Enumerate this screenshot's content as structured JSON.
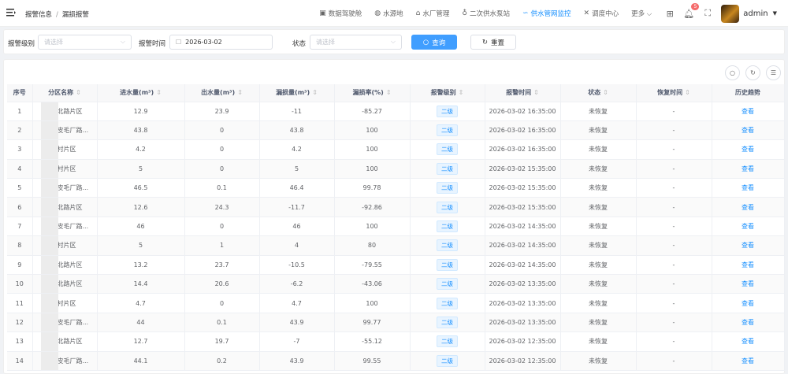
{
  "breadcrumb": [
    "报警信息",
    "漏损报警"
  ],
  "nav": [
    {
      "label": "数据驾驶舱",
      "icon": "monitor-icon",
      "glyph": "▣"
    },
    {
      "label": "水源地",
      "icon": "water-source-icon",
      "glyph": "◍"
    },
    {
      "label": "水厂管理",
      "icon": "home-icon",
      "glyph": "⌂"
    },
    {
      "label": "二次供水泵站",
      "icon": "pump-icon",
      "glyph": "♁"
    },
    {
      "label": "供水管网监控",
      "icon": "pipe-icon",
      "glyph": "∽",
      "active": true
    },
    {
      "label": "调度中心",
      "icon": "tools-icon",
      "glyph": "✕"
    },
    {
      "label": "更多 ⌵",
      "icon": "",
      "glyph": ""
    }
  ],
  "notification_count": "5",
  "user": "admin",
  "filters": {
    "level_label": "报警级别",
    "level_placeholder": "请选择",
    "time_label": "报警时间",
    "time_value": "2026-03-02",
    "status_label": "状态",
    "status_placeholder": "请选择",
    "search": "查询",
    "reset": "重置"
  },
  "columns": [
    "序号",
    "分区名称",
    "进水量(m³)",
    "出水量(m³)",
    "漏损量(m³)",
    "漏损率(%)",
    "报警级别",
    "报警时间",
    "状态",
    "恢复时间",
    "历史趋势"
  ],
  "sortable": [
    false,
    true,
    true,
    true,
    true,
    true,
    true,
    true,
    true,
    true,
    false
  ],
  "rows": [
    [
      "1",
      "北路片区",
      "12.9",
      "23.9",
      "-11",
      "-85.27",
      "二级",
      "2026-03-02 16:35:00",
      "未恢复",
      "-",
      "查看"
    ],
    [
      "2",
      "皮毛厂路...",
      "43.8",
      "0",
      "43.8",
      "100",
      "二级",
      "2026-03-02 16:35:00",
      "未恢复",
      "-",
      "查看"
    ],
    [
      "3",
      "村片区",
      "4.2",
      "0",
      "4.2",
      "100",
      "二级",
      "2026-03-02 16:35:00",
      "未恢复",
      "-",
      "查看"
    ],
    [
      "4",
      "村片区",
      "5",
      "0",
      "5",
      "100",
      "二级",
      "2026-03-02 15:35:00",
      "未恢复",
      "-",
      "查看"
    ],
    [
      "5",
      "皮毛厂路...",
      "46.5",
      "0.1",
      "46.4",
      "99.78",
      "二级",
      "2026-03-02 15:35:00",
      "未恢复",
      "-",
      "查看"
    ],
    [
      "6",
      "北路片区",
      "12.6",
      "24.3",
      "-11.7",
      "-92.86",
      "二级",
      "2026-03-02 15:35:00",
      "未恢复",
      "-",
      "查看"
    ],
    [
      "7",
      "皮毛厂路...",
      "46",
      "0",
      "46",
      "100",
      "二级",
      "2026-03-02 14:35:00",
      "未恢复",
      "-",
      "查看"
    ],
    [
      "8",
      "村片区",
      "5",
      "1",
      "4",
      "80",
      "二级",
      "2026-03-02 14:35:00",
      "未恢复",
      "-",
      "查看"
    ],
    [
      "9",
      "北路片区",
      "13.2",
      "23.7",
      "-10.5",
      "-79.55",
      "二级",
      "2026-03-02 14:35:00",
      "未恢复",
      "-",
      "查看"
    ],
    [
      "10",
      "北路片区",
      "14.4",
      "20.6",
      "-6.2",
      "-43.06",
      "二级",
      "2026-03-02 13:35:00",
      "未恢复",
      "-",
      "查看"
    ],
    [
      "11",
      "村片区",
      "4.7",
      "0",
      "4.7",
      "100",
      "二级",
      "2026-03-02 13:35:00",
      "未恢复",
      "-",
      "查看"
    ],
    [
      "12",
      "皮毛厂路...",
      "44",
      "0.1",
      "43.9",
      "99.77",
      "二级",
      "2026-03-02 13:35:00",
      "未恢复",
      "-",
      "查看"
    ],
    [
      "13",
      "北路片区",
      "12.7",
      "19.7",
      "-7",
      "-55.12",
      "二级",
      "2026-03-02 12:35:00",
      "未恢复",
      "-",
      "查看"
    ],
    [
      "14",
      "皮毛厂路...",
      "44.1",
      "0.2",
      "43.9",
      "99.55",
      "二级",
      "2026-03-02 12:35:00",
      "未恢复",
      "-",
      "查看"
    ]
  ],
  "colors": {
    "accent": "#409eff",
    "link": "#1890ff",
    "badge": "#f56c6c"
  }
}
